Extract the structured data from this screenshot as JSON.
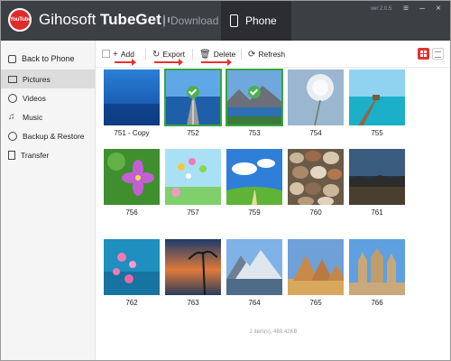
{
  "app": {
    "brand_part1": "Gihosoft ",
    "brand_part2": "TubeGet",
    "logo_text": "YouTube",
    "version": "ver 2.0.5"
  },
  "mode_tabs": [
    {
      "label": "Download",
      "icon": "download-icon",
      "active": false
    },
    {
      "label": "Phone",
      "icon": "phone-icon",
      "active": true
    }
  ],
  "sidebar": {
    "back_label": "Back to Phone",
    "items": [
      {
        "label": "Pictures",
        "icon": "picture-icon",
        "active": true
      },
      {
        "label": "Videos",
        "icon": "video-icon",
        "active": false
      },
      {
        "label": "Music",
        "icon": "music-icon",
        "active": false
      },
      {
        "label": "Backup & Restore",
        "icon": "backup-icon",
        "active": false
      },
      {
        "label": "Transfer",
        "icon": "transfer-icon",
        "active": false
      }
    ]
  },
  "toolbar": {
    "add_label": "Add",
    "export_label": "Export",
    "delete_label": "Delete",
    "refresh_label": "Refresh"
  },
  "photos": [
    {
      "name": "751 - Copy",
      "selected": false
    },
    {
      "name": "752",
      "selected": true
    },
    {
      "name": "753",
      "selected": true
    },
    {
      "name": "754",
      "selected": false
    },
    {
      "name": "755",
      "selected": false
    },
    {
      "name": "756",
      "selected": false
    },
    {
      "name": "757",
      "selected": false
    },
    {
      "name": "759",
      "selected": false
    },
    {
      "name": "760",
      "selected": false
    },
    {
      "name": "761",
      "selected": false
    },
    {
      "name": "762",
      "selected": false
    },
    {
      "name": "763",
      "selected": false
    },
    {
      "name": "764",
      "selected": false
    },
    {
      "name": "765",
      "selected": false
    },
    {
      "name": "766",
      "selected": false
    }
  ],
  "status_text": "2 item(s), 469.42KB",
  "colors": {
    "titlebar": "#3c3f44",
    "accent_red": "#e8322f",
    "selected_green": "#3aa53f"
  }
}
